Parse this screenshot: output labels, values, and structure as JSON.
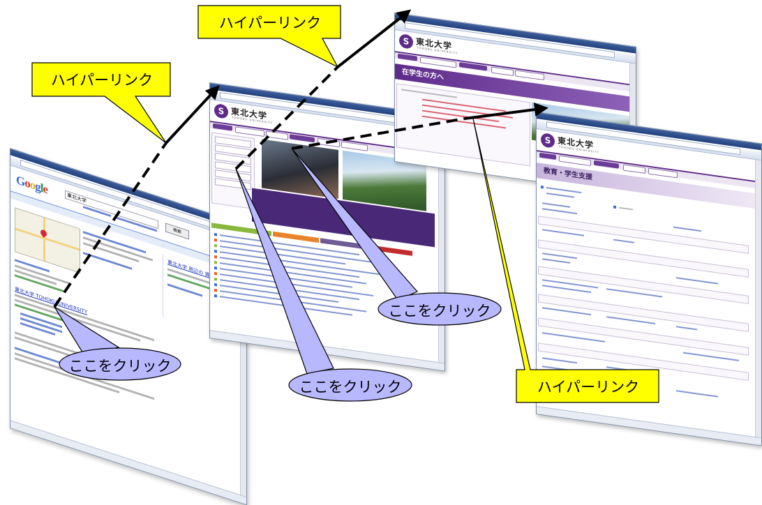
{
  "callouts": {
    "hyperlink_1": "ハイパーリンク",
    "hyperlink_2": "ハイパーリンク",
    "hyperlink_3": "ハイパーリンク",
    "click_1": "ここをクリック",
    "click_2": "ここをクリック",
    "click_3": "ここをクリック"
  },
  "google_window": {
    "logo": [
      "G",
      "o",
      "o",
      "g",
      "l",
      "e"
    ],
    "search_value": "東北大学",
    "search_button": "検索",
    "result_title": "東北大学 TOHOKU UNIVERSITY",
    "ad_title": "東北大学 周辺の 賃貸"
  },
  "tohoku_windows": {
    "university_name": "東北大学",
    "university_sub": "TOHOKU UNIVERSITY",
    "front_heading": "在学生の方へ",
    "right_heading": "教育・学生支援"
  },
  "colors": {
    "callout_yellow": "#ffff00",
    "callout_purple": "#b8b8ff",
    "tohoku_purple": "#5e2b8a",
    "link_blue": "#1a33bb"
  }
}
